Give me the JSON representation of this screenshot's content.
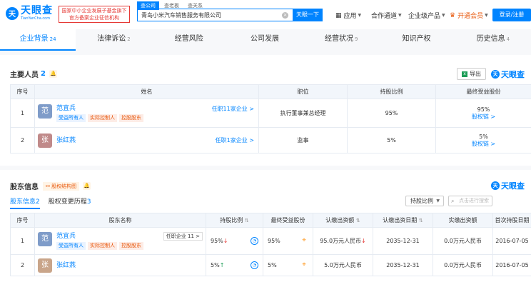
{
  "header": {
    "logo_mark": "天",
    "logo_cn": "天眼查",
    "logo_en": "TianYanCha.com",
    "slogan_line1": "国家中小企业发展子基金旗下",
    "slogan_line2": "官方备案企业征信机构",
    "search_tabs": [
      "查公司",
      "查老板",
      "查关系"
    ],
    "search_value": "青岛小米汽车销售服务有限公司",
    "search_button": "天眼一下",
    "nav": {
      "apps": "应用",
      "channel": "合作通道",
      "enterprise": "企业级产品",
      "vip": "开通会员",
      "login": "登录/注册"
    }
  },
  "tabs": [
    {
      "label": "企业背景",
      "count": "24"
    },
    {
      "label": "法律诉讼",
      "count": "2"
    },
    {
      "label": "经营风险",
      "count": ""
    },
    {
      "label": "公司发展",
      "count": ""
    },
    {
      "label": "经营状况",
      "count": "9"
    },
    {
      "label": "知识产权",
      "count": ""
    },
    {
      "label": "历史信息",
      "count": "4"
    }
  ],
  "key_personnel": {
    "title": "主要人员",
    "count": "2",
    "export": "导出",
    "brand": "天眼查",
    "columns": [
      "序号",
      "姓名",
      "职位",
      "持股比例",
      "最终受益股份"
    ],
    "rows": [
      {
        "index": "1",
        "avatar": "范",
        "avatar_color": "#7f9cc9",
        "name": "范宜兵",
        "tags": [
          "受益所有人",
          "实际控制人",
          "控股股东"
        ],
        "tenure": "任职11家企业 >",
        "position": "执行董事兼总经理",
        "share": "95%",
        "ultimate": "95%",
        "chain": "股权链 >"
      },
      {
        "index": "2",
        "avatar": "张",
        "avatar_color": "#c08a8a",
        "name": "张红燕",
        "tags": [],
        "tenure": "任职1家企业 >",
        "position": "监事",
        "share": "5%",
        "ultimate": "5%",
        "chain": "股权链 >"
      }
    ]
  },
  "shareholders": {
    "title": "股东信息",
    "chip": "股权结构图",
    "brand": "天眼查",
    "sub_tabs": [
      {
        "label": "股东信息",
        "count": "2"
      },
      {
        "label": "股权变更历程",
        "count": "3"
      }
    ],
    "select_value": "持股比例",
    "search_placeholder": "点击进行搜索",
    "columns": [
      "序号",
      "股东名称",
      "持股比例",
      "最终受益股份",
      "认缴出资额",
      "认缴出资日期",
      "实缴出资额",
      "首次持股日期"
    ],
    "rows": [
      {
        "index": "1",
        "avatar": "范",
        "avatar_color": "#7f9cc9",
        "name": "范宜兵",
        "tags": [
          "受益所有人",
          "实际控制人",
          "控股股东"
        ],
        "tenure": "任职企业 11 >",
        "share": "95%",
        "share_trend": "↓",
        "ultimate": "95%",
        "subscribed": "95.0万元人民币",
        "sub_trend": "↓",
        "sub_date": "2035-12-31",
        "paid": "0.0万元人民币",
        "first_date": "2016-07-05"
      },
      {
        "index": "2",
        "avatar": "张",
        "avatar_color": "#c9a58a",
        "name": "张红燕",
        "tags": [],
        "tenure": "",
        "share": "5%",
        "share_trend": "↑",
        "ultimate": "5%",
        "subscribed": "5.0万元人民币",
        "sub_trend": "",
        "sub_date": "2035-12-31",
        "paid": "0.0万元人民币",
        "first_date": "2016-07-05"
      }
    ]
  }
}
